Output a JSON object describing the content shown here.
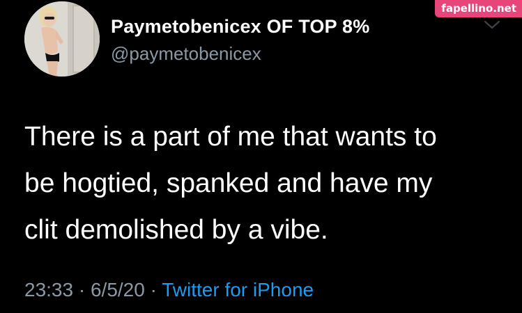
{
  "watermark": "fapellino.net",
  "tweet": {
    "display_name": "Paymetobenicex OF TOP 8%",
    "handle": "@paymetobenicex",
    "text_lines": [
      "There is a part of me that wants to",
      "be hogtied, spanked and have my",
      "clit demolished by a vibe."
    ],
    "time": "23:33",
    "date": "6/5/20",
    "separator": "·",
    "source": "Twitter for iPhone",
    "menu_icon": "chevron-down-icon"
  },
  "colors": {
    "background": "#000000",
    "text": "#ffffff",
    "secondary": "#8b98a5",
    "link": "#1d9bf0",
    "watermark_bg": "#e8457a"
  }
}
